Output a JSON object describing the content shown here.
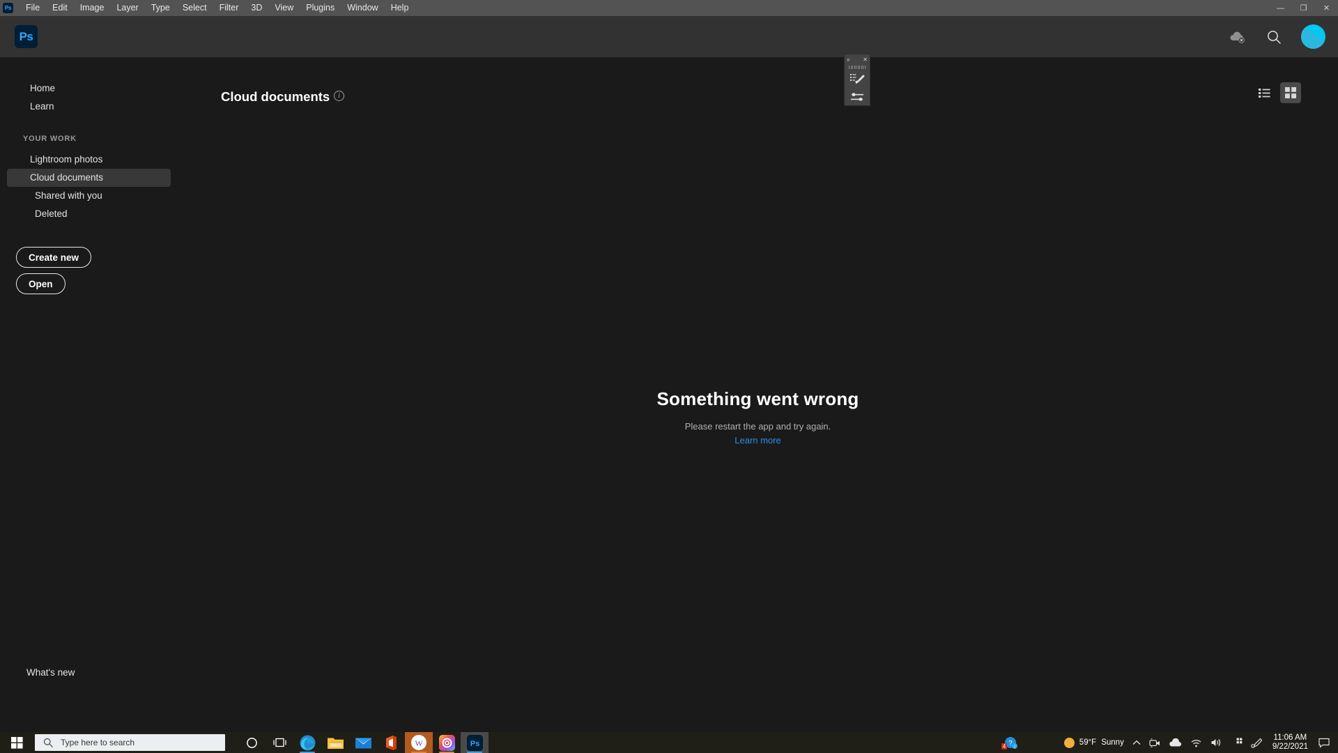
{
  "window": {
    "app_mini_label": "Ps",
    "controls": {
      "minimize": "—",
      "restore": "❐",
      "close": "✕"
    }
  },
  "menubar": {
    "items": [
      "File",
      "Edit",
      "Image",
      "Layer",
      "Type",
      "Select",
      "Filter",
      "3D",
      "View",
      "Plugins",
      "Window",
      "Help"
    ]
  },
  "header": {
    "logo_label": "Ps",
    "icons": [
      "cloud-offline-icon",
      "search-icon",
      "avatar"
    ]
  },
  "sidebar": {
    "items": [
      {
        "label": "Home",
        "active": false,
        "sub": false
      },
      {
        "label": "Learn",
        "active": false,
        "sub": false
      }
    ],
    "group_label": "YOUR WORK",
    "work_items": [
      {
        "label": "Lightroom photos",
        "active": false,
        "sub": false
      },
      {
        "label": "Cloud documents",
        "active": true,
        "sub": false
      },
      {
        "label": "Shared with you",
        "active": false,
        "sub": true
      },
      {
        "label": "Deleted",
        "active": false,
        "sub": true
      }
    ],
    "create_new_label": "Create new",
    "open_label": "Open",
    "whats_new_label": "What's new"
  },
  "main": {
    "page_title": "Cloud documents",
    "info_glyph": "i",
    "view_list_label": "list-view",
    "view_grid_label": "grid-view",
    "error": {
      "title": "Something went wrong",
      "subtitle": "Please restart the app and try again.",
      "link": "Learn more",
      "link_color": "#2d8ceb"
    }
  },
  "float_panel": {
    "collapse_glyph": "»",
    "close_glyph": "✕",
    "tools": [
      "brush-presets-icon",
      "brush-settings-icon"
    ]
  },
  "taskbar": {
    "start_label": "start-button",
    "search_placeholder": "Type here to search",
    "apps": [
      {
        "name": "cortana-icon"
      },
      {
        "name": "task-view-icon"
      },
      {
        "name": "microsoft-edge-icon"
      },
      {
        "name": "file-explorer-icon"
      },
      {
        "name": "mail-icon"
      },
      {
        "name": "office-icon"
      },
      {
        "name": "w-app-icon"
      },
      {
        "name": "creative-cloud-icon"
      },
      {
        "name": "photoshop-icon"
      }
    ],
    "tray": {
      "help_icon": "help-icon",
      "weather_temp": "59°F",
      "weather_condition": "Sunny",
      "notification_badge": "4",
      "time": "11:06 AM",
      "date": "9/22/2021"
    }
  }
}
